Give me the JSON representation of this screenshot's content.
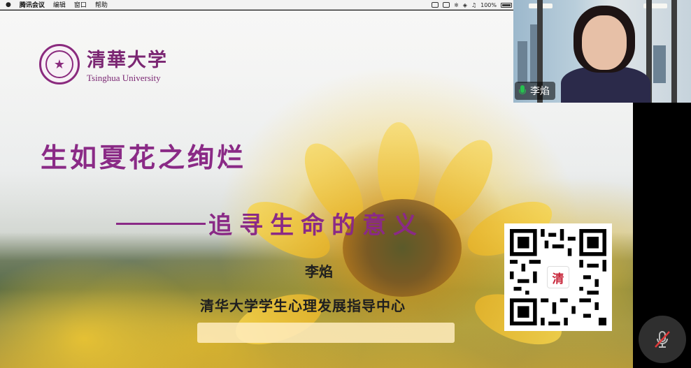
{
  "menubar": {
    "app_name": "腾讯会议",
    "menus": [
      "编辑",
      "窗口",
      "帮助"
    ],
    "battery": "100%"
  },
  "slide": {
    "logo": {
      "cn": "清華大学",
      "en": "Tsinghua University"
    },
    "title": "生如夏花之绚烂",
    "subtitle": "追寻生命的意义",
    "presenter": "李焰",
    "organization": "清华大学学生心理发展指导中心",
    "qr_badge": "清"
  },
  "participant": {
    "name": "李焰",
    "mic_status": "speaking"
  },
  "controls": {
    "mute_button": "muted"
  },
  "colors": {
    "title_purple": "#8a2a86",
    "logo_purple": "#7b2773",
    "mic_green": "#26c14e",
    "mute_red": "#e03a3a"
  }
}
